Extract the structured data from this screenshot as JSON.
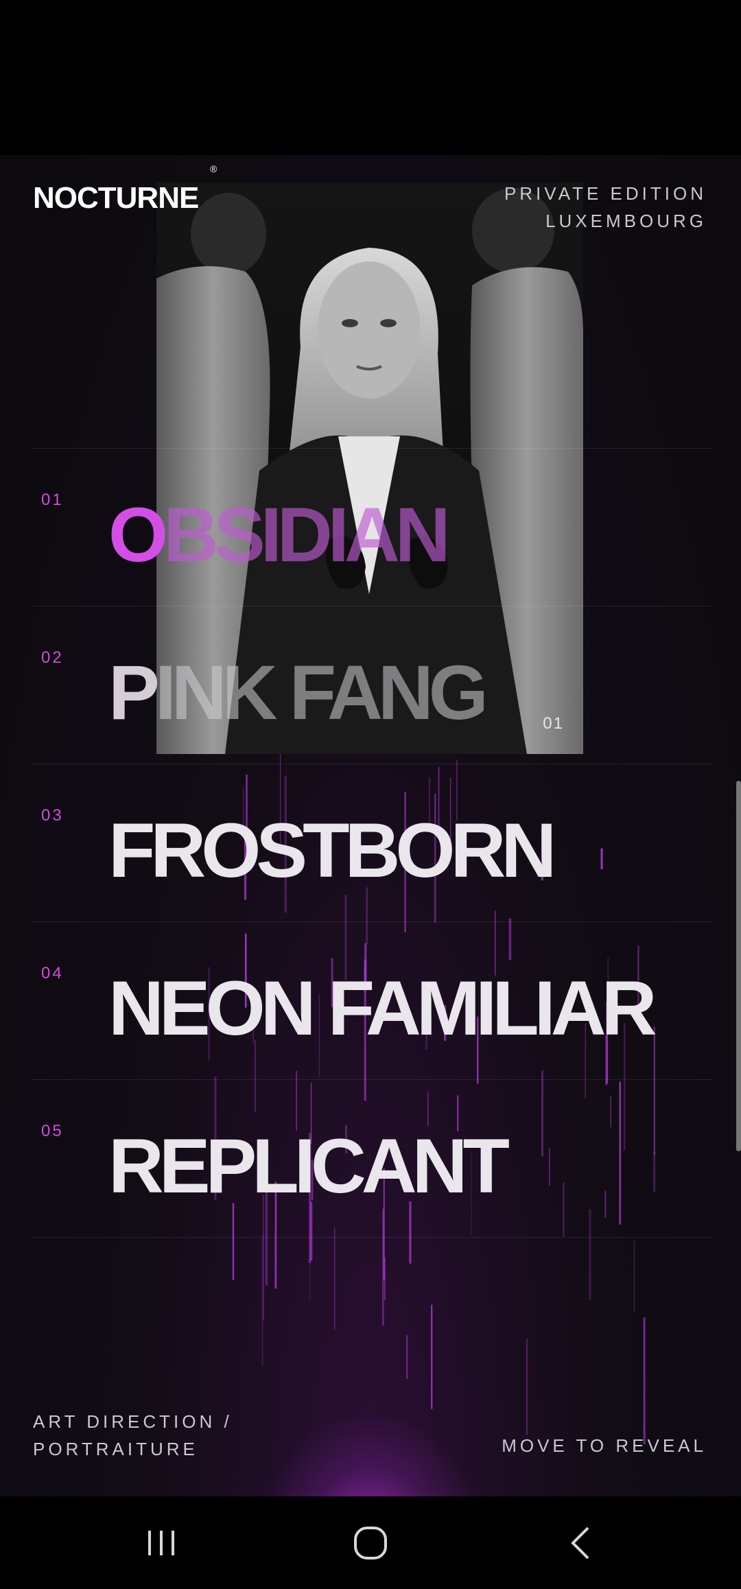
{
  "brand": {
    "name": "NOCTURNE",
    "registered": "®"
  },
  "edition": {
    "line1": "PRIVATE EDITION",
    "line2": "LUXEMBOURG"
  },
  "portrait": {
    "index": "01"
  },
  "menu": [
    {
      "number": "01",
      "first": "O",
      "rest": "BSIDIAN"
    },
    {
      "number": "02",
      "first": "P",
      "rest": "INK FANG"
    },
    {
      "number": "03",
      "first": "F",
      "rest": "ROSTBORN"
    },
    {
      "number": "04",
      "first": "N",
      "rest": "EON FAMILIAR"
    },
    {
      "number": "05",
      "first": "R",
      "rest": "EPLICANT"
    }
  ],
  "footer": {
    "left_line1": "ART DIRECTION /",
    "left_line2": "PORTRAITURE",
    "right": "MOVE TO REVEAL"
  },
  "colors": {
    "accent": "#d24ae0",
    "rain": "#b33bd6",
    "background": "#0c0a0e"
  },
  "navigation": {
    "recents": "recents-icon",
    "home": "home-icon",
    "back": "back-icon"
  }
}
